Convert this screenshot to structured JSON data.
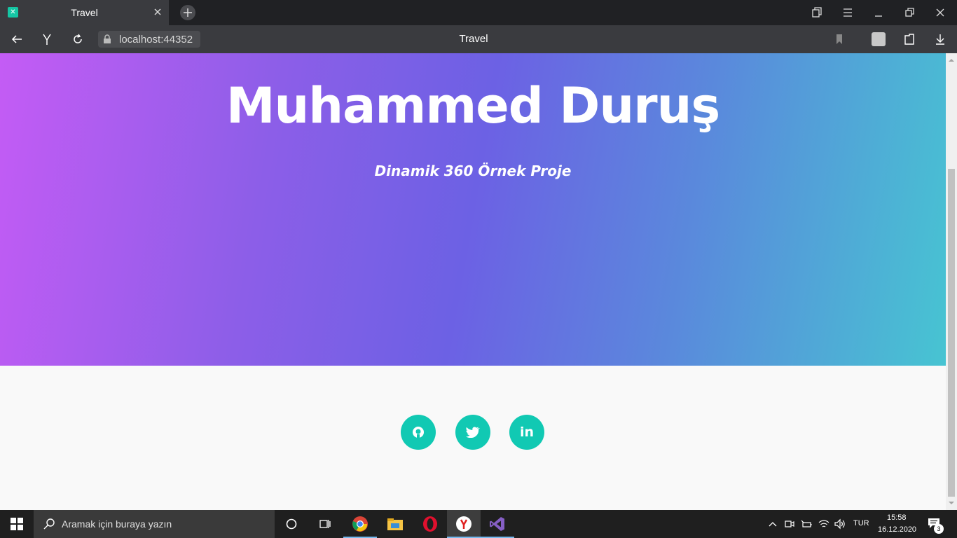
{
  "browser": {
    "tab_title": "Travel",
    "favicon_glyph": "✕",
    "url": "localhost:44352",
    "window_title": "Travel"
  },
  "page": {
    "title": "Muhammed Duruş",
    "subtitle": "Dinamik 360 Örnek Proje",
    "social_links": [
      {
        "name": "github",
        "icon": "github-icon"
      },
      {
        "name": "twitter",
        "icon": "twitter-icon"
      },
      {
        "name": "linkedin",
        "icon": "linkedin-icon",
        "label": "in"
      }
    ],
    "colors": {
      "gradient_start": "#c45cf5",
      "gradient_mid": "#6c61e4",
      "gradient_end": "#47c4d2",
      "social_bg": "#11c9b3"
    }
  },
  "taskbar": {
    "search_placeholder": "Aramak için buraya yazın",
    "apps": [
      "cortana-icon",
      "task-view-icon",
      "chrome-icon",
      "file-explorer-icon",
      "opera-icon",
      "yandex-icon",
      "visual-studio-icon"
    ],
    "language": "TUR",
    "time": "15:58",
    "date": "16.12.2020",
    "notifications": "3"
  }
}
